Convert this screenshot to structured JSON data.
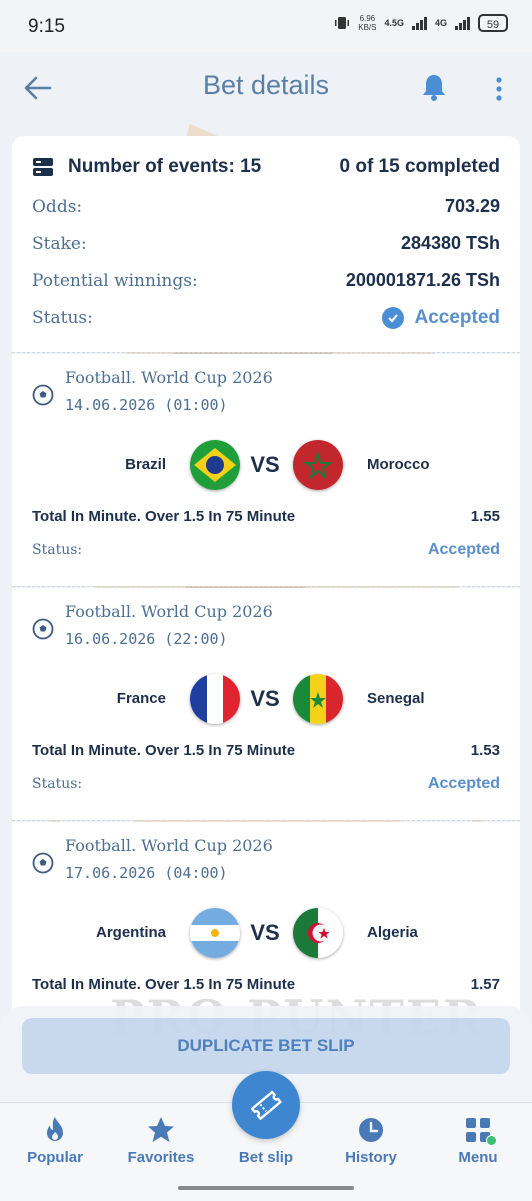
{
  "status_bar": {
    "time": "9:15",
    "speed_top": "6.96",
    "speed_bottom": "KB/S",
    "net1": "4.5G",
    "net2": "4G",
    "battery": "59"
  },
  "header": {
    "title": "Bet details"
  },
  "summary": {
    "events_label": "Number of events: 15",
    "completed": "0 of 15 completed",
    "odds_label": "Odds:",
    "odds_value": "703.29",
    "stake_label": "Stake:",
    "stake_value": "284380 TSh",
    "winnings_label": "Potential winnings:",
    "winnings_value": "200001871.26 TSh",
    "status_label": "Status:",
    "status_value": "Accepted"
  },
  "events": [
    {
      "league": "Football. World Cup 2026",
      "date": "14.06.2026 (01:00)",
      "team1": "Brazil",
      "team2": "Morocco",
      "vs": "VS",
      "market": "Total In Minute. Over 1.5 In 75 Minute",
      "coef": "1.55",
      "status_label": "Status:",
      "status": "Accepted"
    },
    {
      "league": "Football. World Cup 2026",
      "date": "16.06.2026 (22:00)",
      "team1": "France",
      "team2": "Senegal",
      "vs": "VS",
      "market": "Total In Minute. Over 1.5 In 75 Minute",
      "coef": "1.53",
      "status_label": "Status:",
      "status": "Accepted"
    },
    {
      "league": "Football. World Cup 2026",
      "date": "17.06.2026 (04:00)",
      "team1": "Argentina",
      "team2": "Algeria",
      "vs": "VS",
      "market": "Total In Minute. Over 1.5 In 75 Minute",
      "coef": "1.57"
    }
  ],
  "watermark": "PRO PUNTER",
  "actions": {
    "duplicate": "DUPLICATE BET SLIP"
  },
  "nav": {
    "popular": "Popular",
    "favorites": "Favorites",
    "bet_slip": "Bet slip",
    "history": "History",
    "menu": "Menu"
  },
  "colors": {
    "accent": "#3e86cf",
    "link": "#5a8fcb",
    "text": "#1d2f4a"
  }
}
